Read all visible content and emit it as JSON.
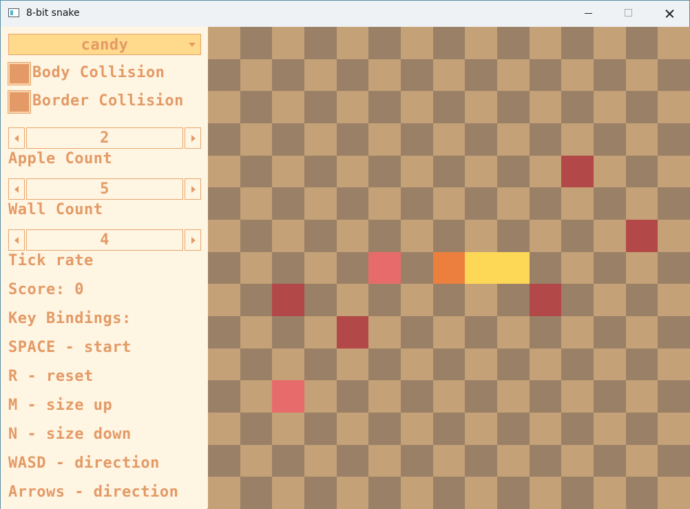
{
  "window": {
    "title": "8-bit snake"
  },
  "controls": {
    "theme": {
      "selected": "candy"
    },
    "body_collision": {
      "label": "Body Collision",
      "checked": true
    },
    "border_collision": {
      "label": "Border Collision",
      "checked": true
    },
    "apple_count": {
      "value": "2",
      "label": "Apple Count"
    },
    "wall_count": {
      "value": "5",
      "label": "Wall Count"
    },
    "tick_rate": {
      "value": "4",
      "label": "Tick rate"
    },
    "score": "Score: 0",
    "key_bindings": {
      "title": "Key Bindings:",
      "items": [
        "SPACE - start",
        "R - reset",
        "M - size up",
        "N - size down",
        "WASD - direction",
        "Arrows - direction"
      ]
    }
  },
  "board": {
    "cols": 15,
    "rows": 15,
    "colors": {
      "light": "#c4a177",
      "dark": "#9a8066",
      "wall": "#b34848",
      "apple": "#e86b6b",
      "snake_head": "#ed7f3e",
      "snake_body": "#fdd857"
    },
    "cells": [
      {
        "kind": "wall",
        "col": 11,
        "row": 4
      },
      {
        "kind": "wall",
        "col": 13,
        "row": 6
      },
      {
        "kind": "wall",
        "col": 2,
        "row": 8
      },
      {
        "kind": "wall",
        "col": 10,
        "row": 8
      },
      {
        "kind": "wall",
        "col": 4,
        "row": 9
      },
      {
        "kind": "apple",
        "col": 5,
        "row": 7
      },
      {
        "kind": "apple",
        "col": 2,
        "row": 11
      },
      {
        "kind": "snake_head",
        "col": 7,
        "row": 7
      },
      {
        "kind": "snake_body",
        "col": 8,
        "row": 7
      },
      {
        "kind": "snake_body",
        "col": 9,
        "row": 7
      }
    ]
  }
}
